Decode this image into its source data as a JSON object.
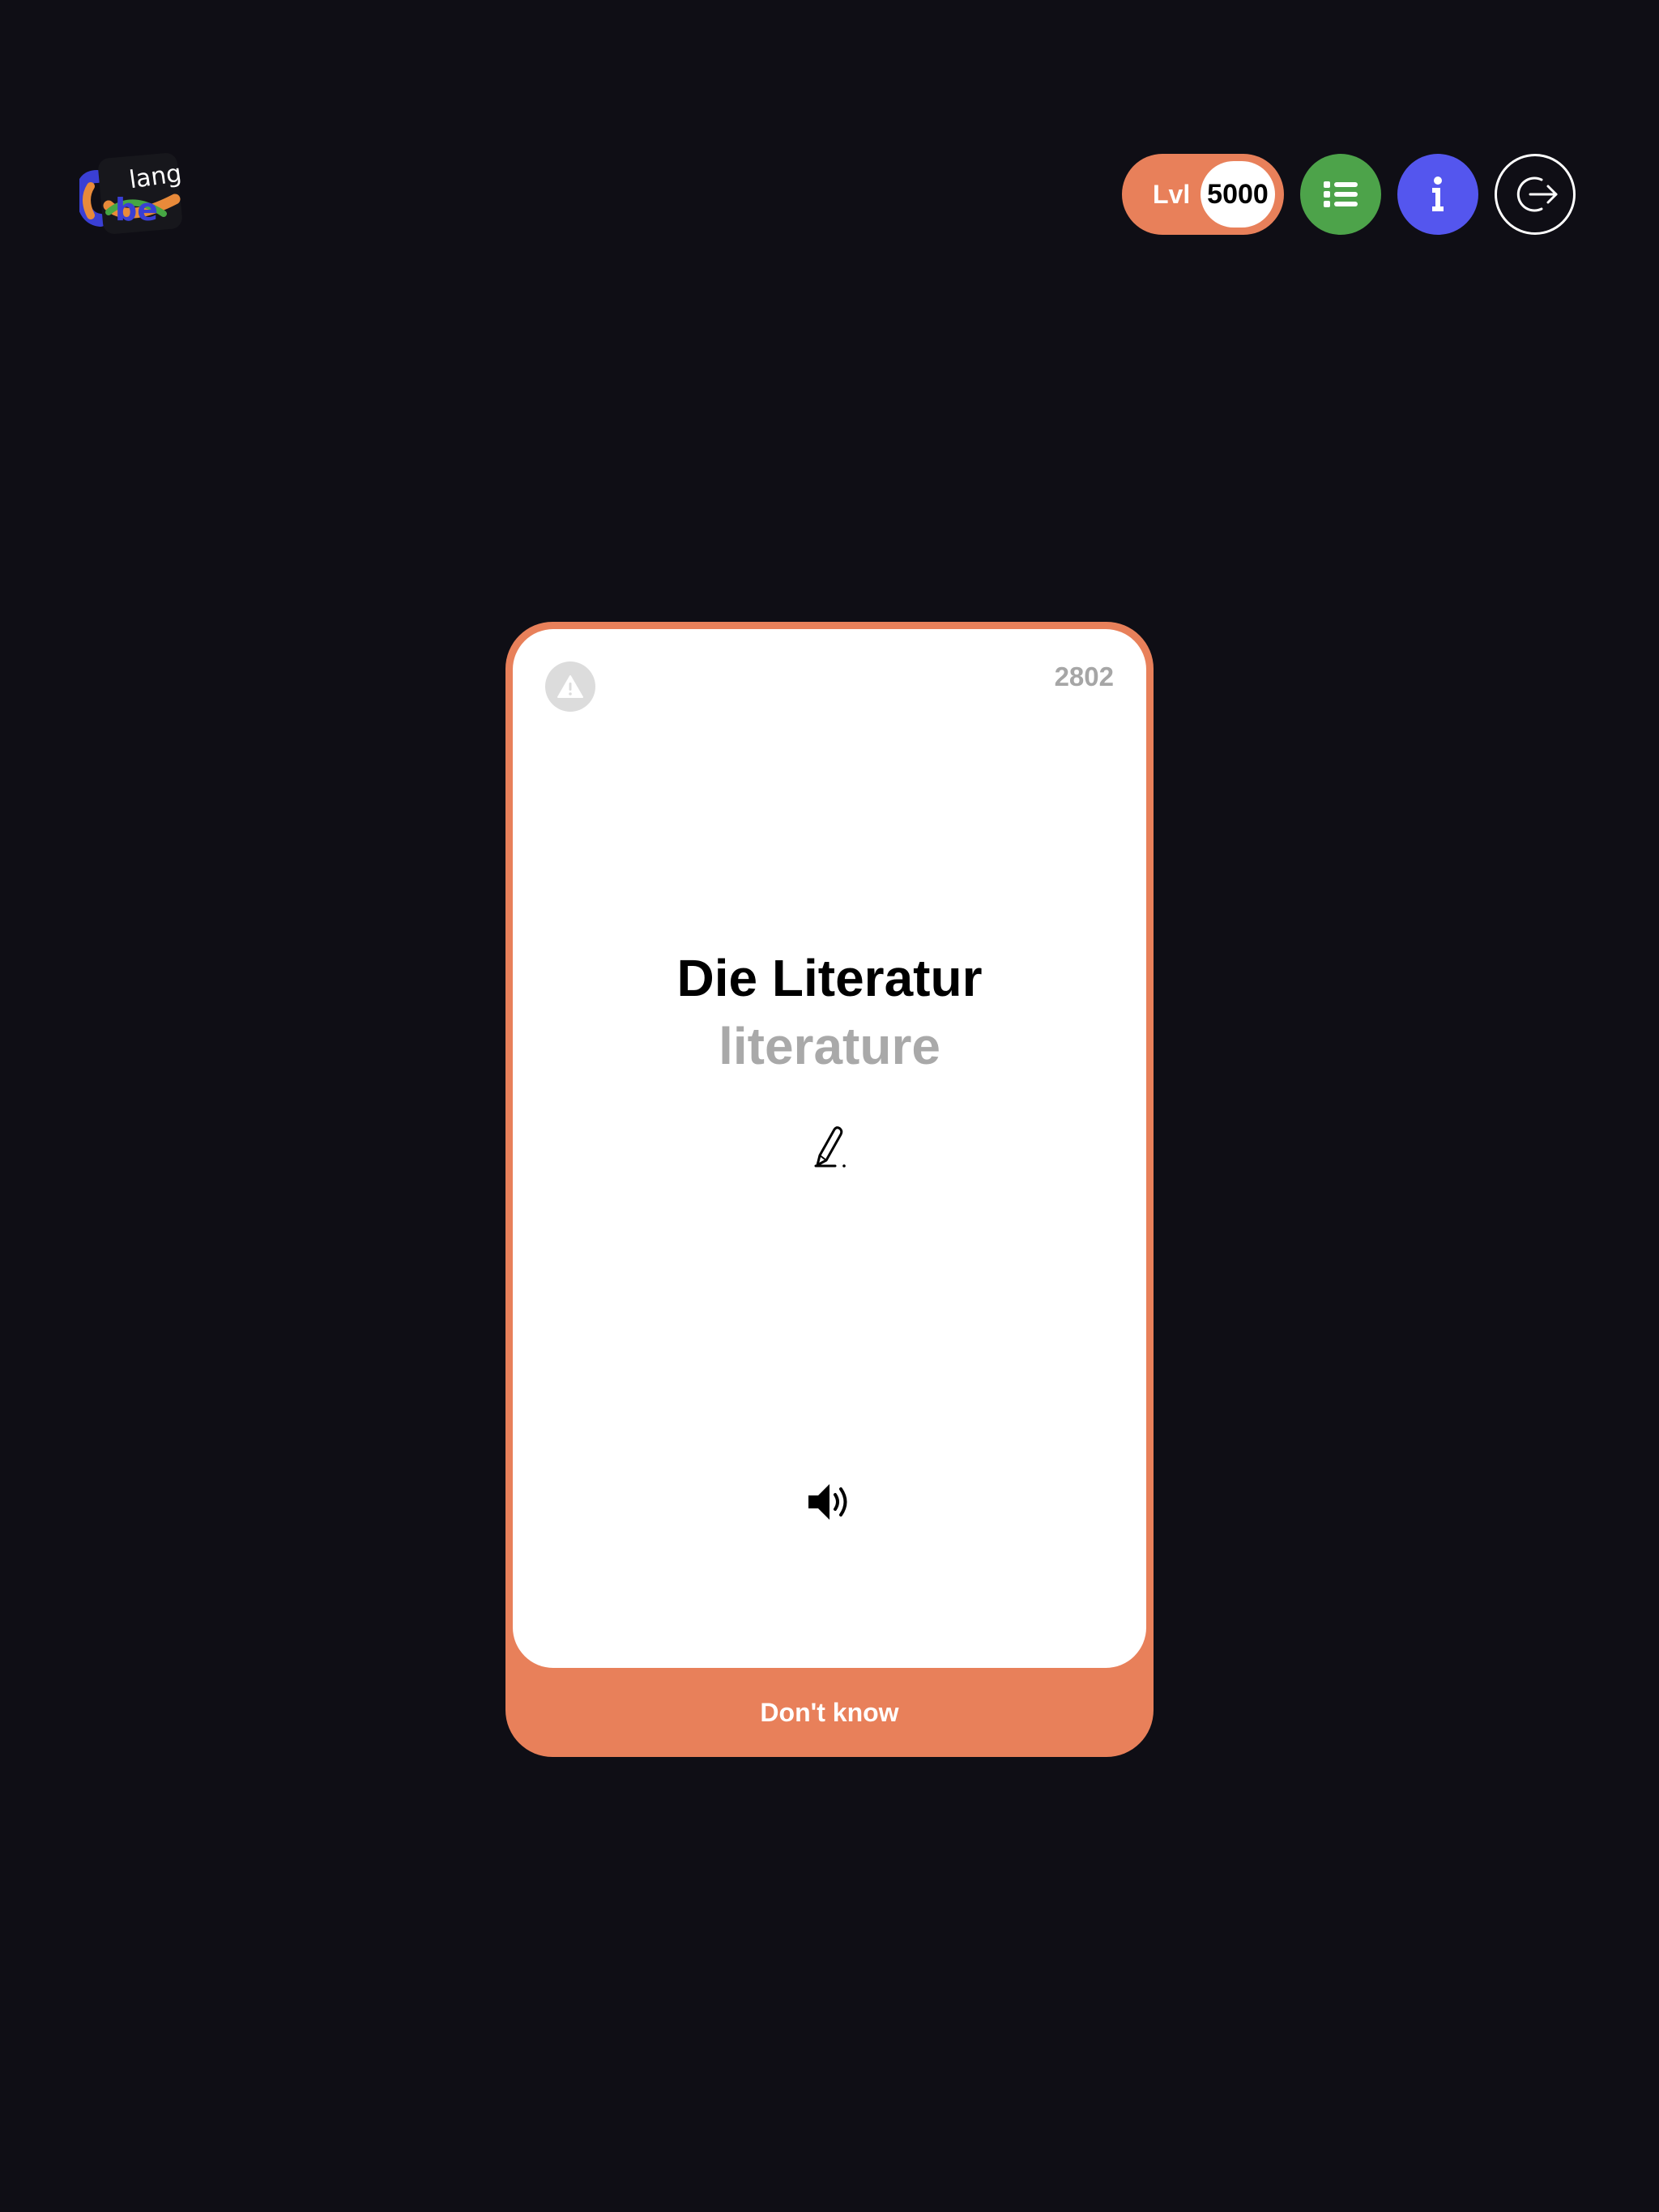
{
  "header": {
    "logo_text_top": "lang",
    "logo_text_bottom": "be",
    "level_label": "Lvl",
    "level_value": "5000",
    "icons": {
      "list": "list-icon",
      "info": "info-icon",
      "logout": "logout-icon"
    }
  },
  "card": {
    "number": "2802",
    "word": "Die Literatur",
    "translation": "literature",
    "dont_know_label": "Don't know",
    "icons": {
      "report": "warning-icon",
      "write": "pen-icon",
      "audio": "speaker-icon"
    }
  },
  "colors": {
    "background": "#0f0e15",
    "accent": "#e8805a",
    "list_button": "#4da34a",
    "info_button": "#5456ee"
  }
}
